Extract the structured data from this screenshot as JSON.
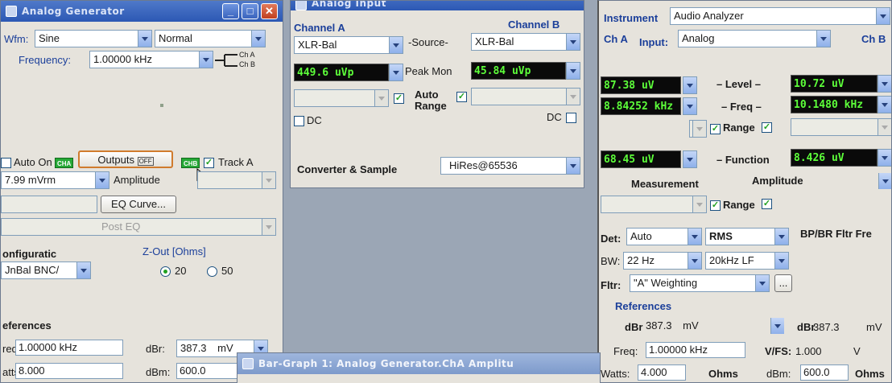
{
  "gen": {
    "title": "Analog Generator",
    "wfm_label": "Wfm:",
    "wfm_value": "Sine",
    "mode_value": "Normal",
    "freq_label": "Frequency:",
    "freq_value": "1.00000 kHz",
    "cha": "Ch A",
    "chb": "Ch B",
    "auto_on": "Auto On",
    "cha_chip": "CHA",
    "outputs": "Outputs",
    "off_chip": "OFF",
    "chb_chip": "CHB",
    "track_a": "Track A",
    "ampl_value": "7.99 mVrm",
    "ampl_label": "Amplitude",
    "eq_curve": "EQ Curve...",
    "post_eq": "Post EQ",
    "config_label": "onfiguratic",
    "config_value": "JnBal BNC/",
    "zout_label": "Z-Out [Ohms]",
    "z20": "20",
    "z50": "50",
    "refs_label": "eferences",
    "ref_freq_label": "req:",
    "ref_freq_value": "1.00000 kHz",
    "dbr_label": "dBr:",
    "dbr_value": "387.3",
    "dbr_unit": "mV",
    "watts_label": "atts:",
    "watts_value": "8.000",
    "dbm_label": "dBm:",
    "dbm_value": "600.0"
  },
  "input": {
    "title": "Analog Input",
    "cha": "Channel A",
    "chb": "Channel B",
    "source_label": "-Source-",
    "src_a": "XLR-Bal",
    "src_b": "XLR-Bal",
    "peak_a": "449.6  uVp",
    "peak_label": "Peak Mon",
    "peak_b": "45.84  uVp",
    "auto_range": "Auto Range",
    "dc_a": "DC",
    "dc_b": "DC",
    "conv_label": "Converter & Sample",
    "conv_value": "HiRes@65536"
  },
  "analyzer": {
    "instr_label": "Instrument",
    "instr_value": "Audio Analyzer",
    "cha": "Ch A",
    "input_label": "Input:",
    "input_value": "Analog",
    "chb": "Ch B",
    "level_a": "87.38  uV",
    "level_label": "– Level –",
    "level_b": "10.72  uV",
    "freq_a": "8.84252 kHz",
    "freq_label": "– Freq –",
    "freq_b": "10.1480 kHz",
    "range": "Range",
    "func_a": "68.45  uV",
    "func_label": "– Function",
    "func_b": "8.426  uV",
    "meas_label": "Measurement",
    "meas_value": "Amplitude",
    "det_label": "Det:",
    "det_value": "Auto",
    "rms_value": "RMS",
    "bp_label": "BP/BR Fltr Fre",
    "bw_label": "BW:",
    "bw_value": "22 Hz",
    "lf_value": "20kHz LF",
    "fltr_label": "Fltr:",
    "fltr_value": "\"A\" Weighting",
    "more": "...",
    "refs_label": "References",
    "dbr_label": "dBr",
    "dbr_a": "387.3",
    "dbr_unit_a": "mV",
    "dbr_b": "387.3",
    "dbr_unit_b": "mV",
    "ref_freq_label": "Freq:",
    "ref_freq_value": "1.00000 kHz",
    "vfs_label": "V/FS:",
    "vfs_value": "1.000",
    "vfs_unit": "V",
    "watts_label": "Watts:",
    "watts_value": "4.000",
    "watts_unit": "Ohms",
    "dbm_label": "dBm:",
    "dbm_value": "600.0",
    "dbm_unit": "Ohms"
  },
  "bargraph": {
    "title": "Bar-Graph 1: Analog Generator.ChA Amplitu"
  }
}
